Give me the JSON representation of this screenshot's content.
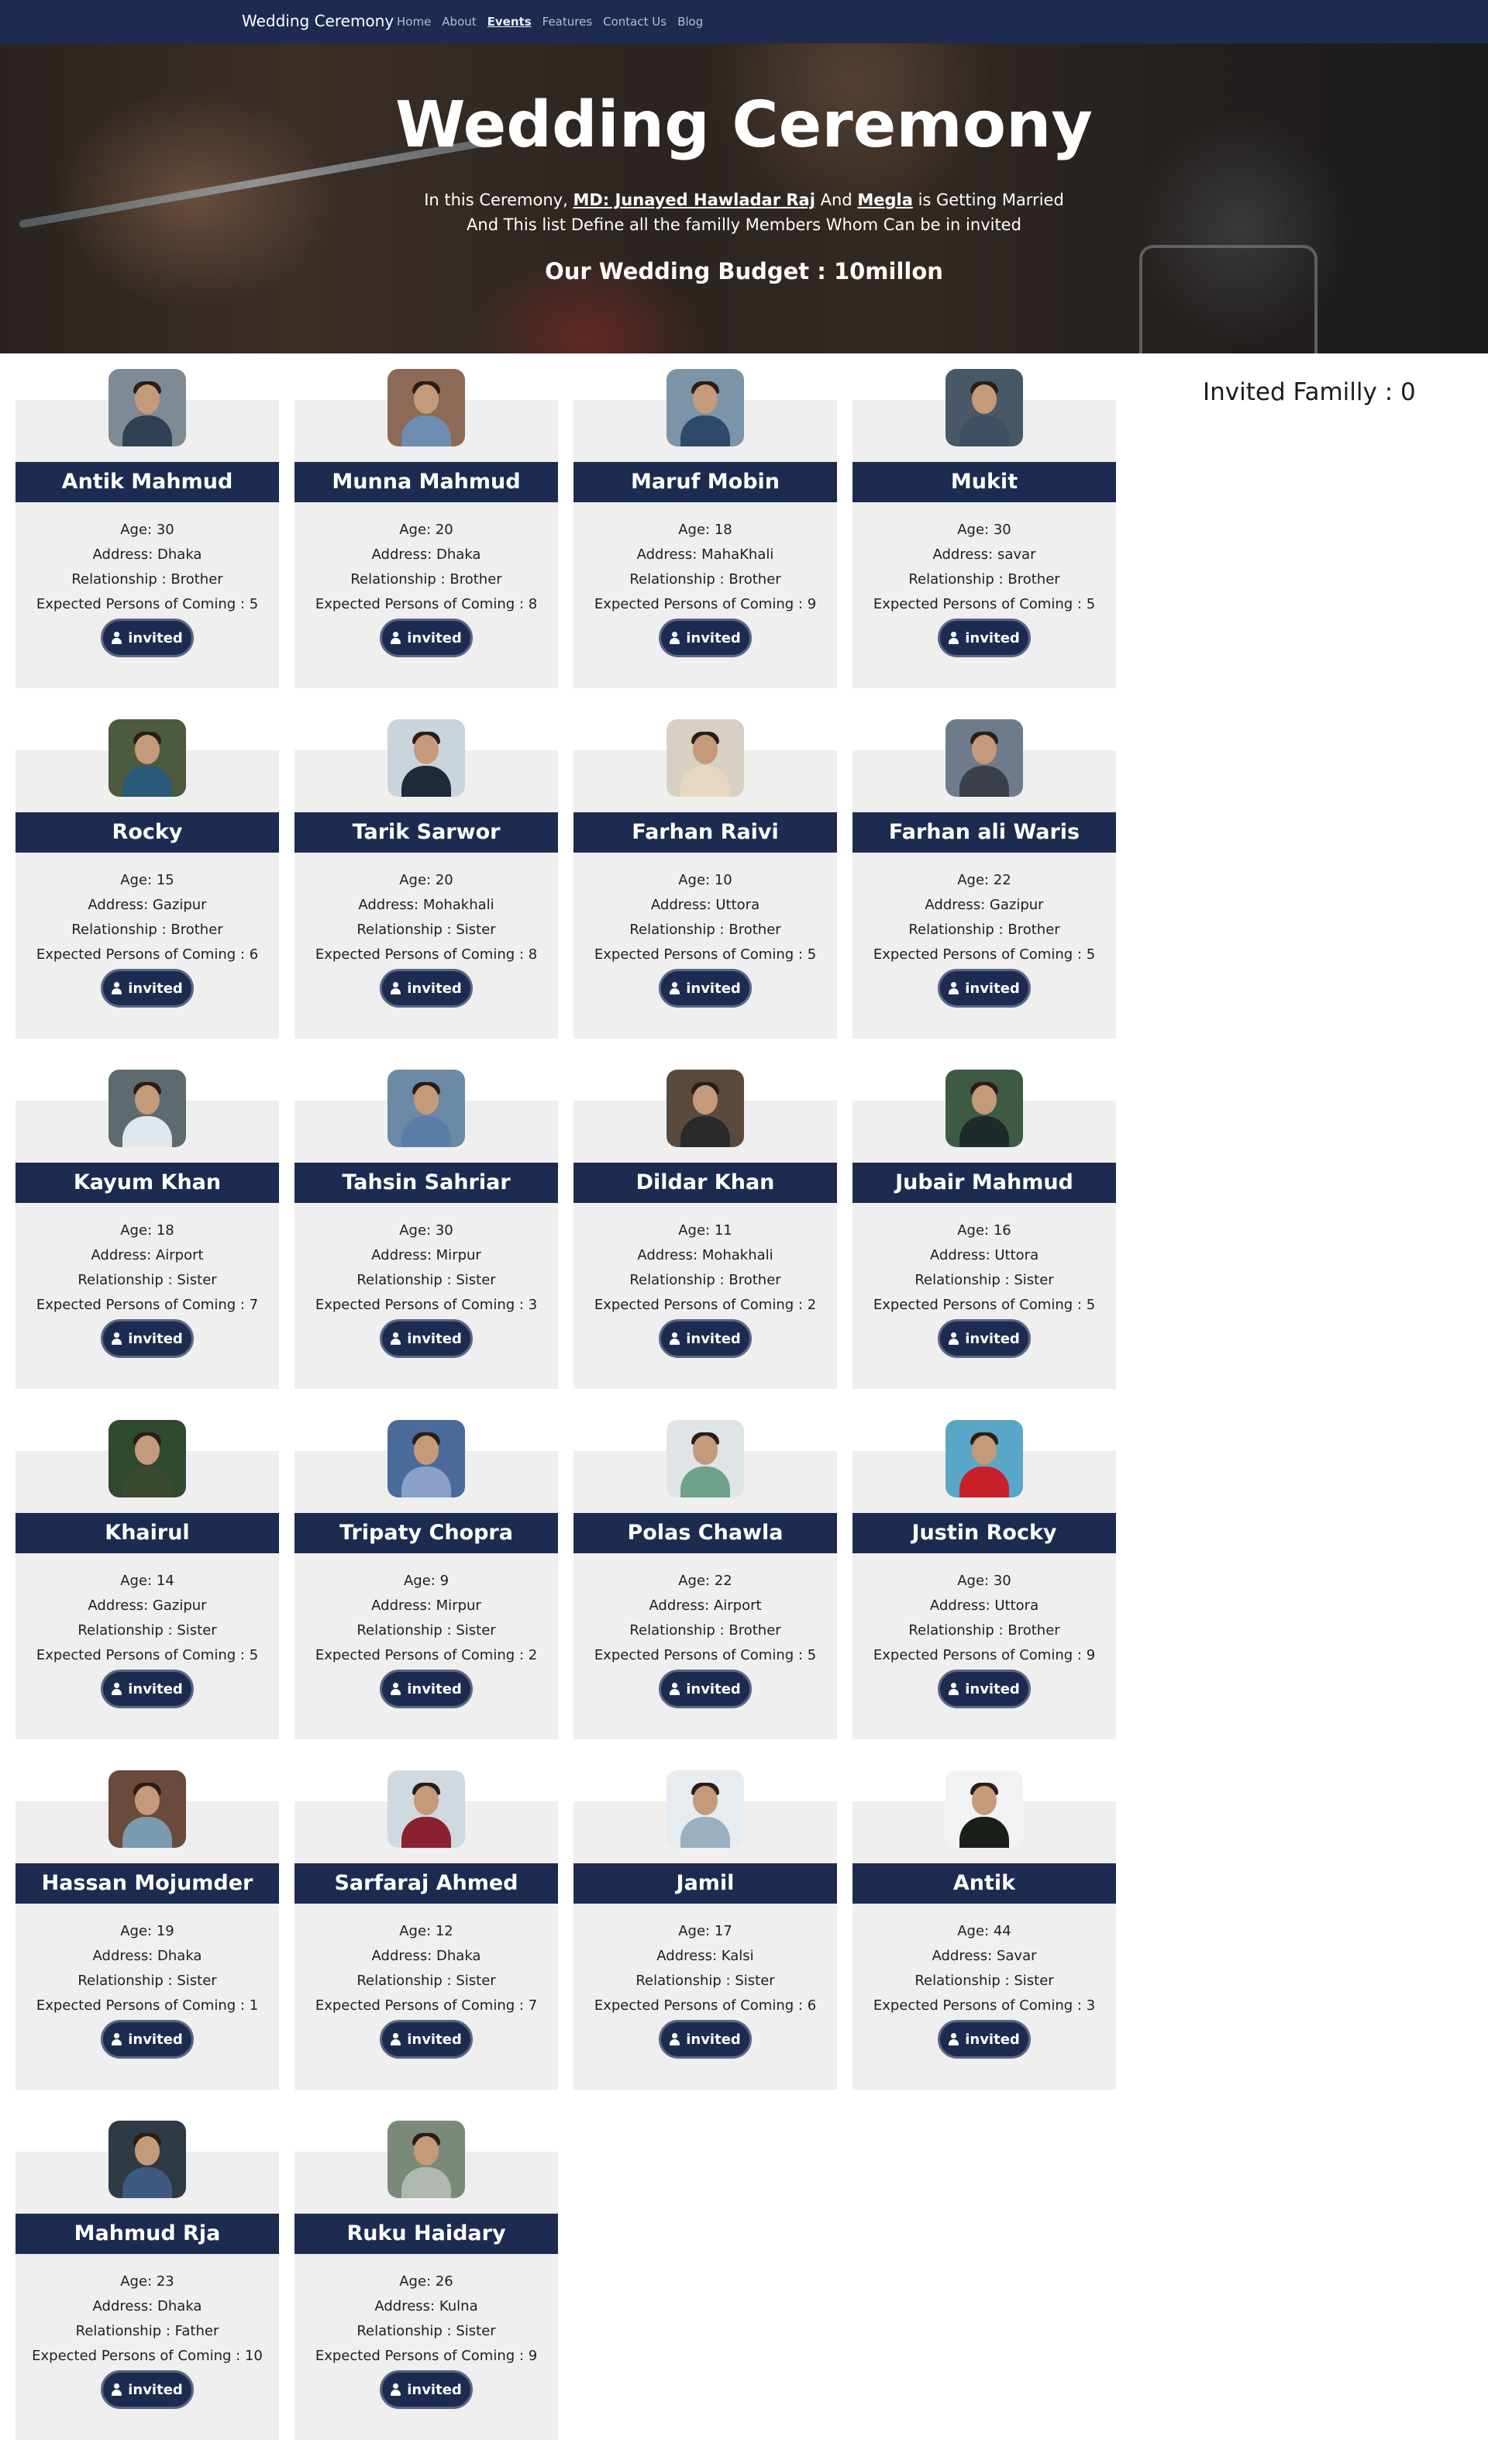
{
  "nav": {
    "brand": "Wedding Ceremony",
    "links": [
      "Home",
      "About",
      "Events",
      "Features",
      "Contact Us",
      "Blog"
    ],
    "active_link": "Events"
  },
  "hero": {
    "title": "Wedding Ceremony",
    "line1_prefix": "In this Ceremony,",
    "groom": "MD: Junayed Hawladar Raj",
    "line1_and": "And",
    "bride": "Megla",
    "line1_suffix": "is Getting Married",
    "line2": "And This list Define all the familly Members Whom Can be in invited",
    "budget": "Our Wedding Budget : 10millon"
  },
  "sidebar": {
    "invited_count": "Invited Familly : 0"
  },
  "labels": {
    "age": "Age:",
    "address": "Address:",
    "relationship": "Relationship :",
    "expected": "Expected Persons of Coming :",
    "button": "invited"
  },
  "members": [
    {
      "name": "Antik Mahmud",
      "age": 30,
      "address": "Dhaka",
      "relationship": "Brother",
      "expected": 5
    },
    {
      "name": "Munna Mahmud",
      "age": 20,
      "address": "Dhaka",
      "relationship": "Brother",
      "expected": 8
    },
    {
      "name": "Maruf Mobin",
      "age": 18,
      "address": "MahaKhali",
      "relationship": "Brother",
      "expected": 9
    },
    {
      "name": "Mukit",
      "age": 30,
      "address": "savar",
      "relationship": "Brother",
      "expected": 5
    },
    {
      "name": "Rocky",
      "age": 15,
      "address": "Gazipur",
      "relationship": "Brother",
      "expected": 6
    },
    {
      "name": "Tarik Sarwor",
      "age": 20,
      "address": "Mohakhali",
      "relationship": "Sister",
      "expected": 8
    },
    {
      "name": "Farhan Raivi",
      "age": 10,
      "address": "Uttora",
      "relationship": "Brother",
      "expected": 5
    },
    {
      "name": "Farhan ali Waris",
      "age": 22,
      "address": "Gazipur",
      "relationship": "Brother",
      "expected": 5
    },
    {
      "name": "Kayum Khan",
      "age": 18,
      "address": "Airport",
      "relationship": "Sister",
      "expected": 7
    },
    {
      "name": "Tahsin Sahriar",
      "age": 30,
      "address": "Mirpur",
      "relationship": "Sister",
      "expected": 3
    },
    {
      "name": "Dildar Khan",
      "age": 11,
      "address": "Mohakhali",
      "relationship": "Brother",
      "expected": 2
    },
    {
      "name": "Jubair Mahmud",
      "age": 16,
      "address": "Uttora",
      "relationship": "Sister",
      "expected": 5
    },
    {
      "name": "Khairul",
      "age": 14,
      "address": "Gazipur",
      "relationship": "Sister",
      "expected": 5
    },
    {
      "name": "Tripaty Chopra",
      "age": 9,
      "address": "Mirpur",
      "relationship": "Sister",
      "expected": 2
    },
    {
      "name": "Polas Chawla",
      "age": 22,
      "address": "Airport",
      "relationship": "Brother",
      "expected": 5
    },
    {
      "name": "Justin Rocky",
      "age": 30,
      "address": "Uttora",
      "relationship": "Brother",
      "expected": 9
    },
    {
      "name": "Hassan Mojumder",
      "age": 19,
      "address": "Dhaka",
      "relationship": "Sister",
      "expected": 1
    },
    {
      "name": "Sarfaraj Ahmed",
      "age": 12,
      "address": "Dhaka",
      "relationship": "Sister",
      "expected": 7
    },
    {
      "name": "Jamil",
      "age": 17,
      "address": "Kalsi",
      "relationship": "Sister",
      "expected": 6
    },
    {
      "name": "Antik",
      "age": 44,
      "address": "Savar",
      "relationship": "Sister",
      "expected": 3
    },
    {
      "name": "Mahmud Rja",
      "age": 23,
      "address": "Dhaka",
      "relationship": "Father",
      "expected": 10
    },
    {
      "name": "Ruku Haidary",
      "age": 26,
      "address": "Kulna",
      "relationship": "Sister",
      "expected": 9
    }
  ],
  "colors": {
    "navy": "#1d2b50",
    "card_bg": "#efefef",
    "avatar_backgrounds": [
      "#7e8a94",
      "#8c6a56",
      "#7b94a8",
      "#495866",
      "#4d5a3e",
      "#c9d4db",
      "#d9d0c4",
      "#6d7b8a",
      "#5d6a6e",
      "#6a8aa6",
      "#5a4a3e",
      "#3e5a44",
      "#2f4a2e",
      "#4a6a9a",
      "#dfe4e6",
      "#5aa6c8",
      "#6a4a3a",
      "#d0d8e0",
      "#e6ecf0",
      "#f2f2f2",
      "#2e3a46",
      "#7a8a7a"
    ],
    "shirt_colors": [
      "#2f3f55",
      "#6e8db0",
      "#2e4a6a",
      "#3f4f66",
      "#2a5a7a",
      "#1e2a3a",
      "#e6d8c0",
      "#3a3f48",
      "#dfe6ee",
      "#5a7ea8",
      "#2a2a2a",
      "#1f2a2a",
      "#3a4a2e",
      "#8aa0c8",
      "#6fa08a",
      "#c8202a",
      "#7a9ab0",
      "#8a2030",
      "#9ab0c0",
      "#1a1f1a",
      "#3e5a80",
      "#b0b8b0"
    ]
  }
}
